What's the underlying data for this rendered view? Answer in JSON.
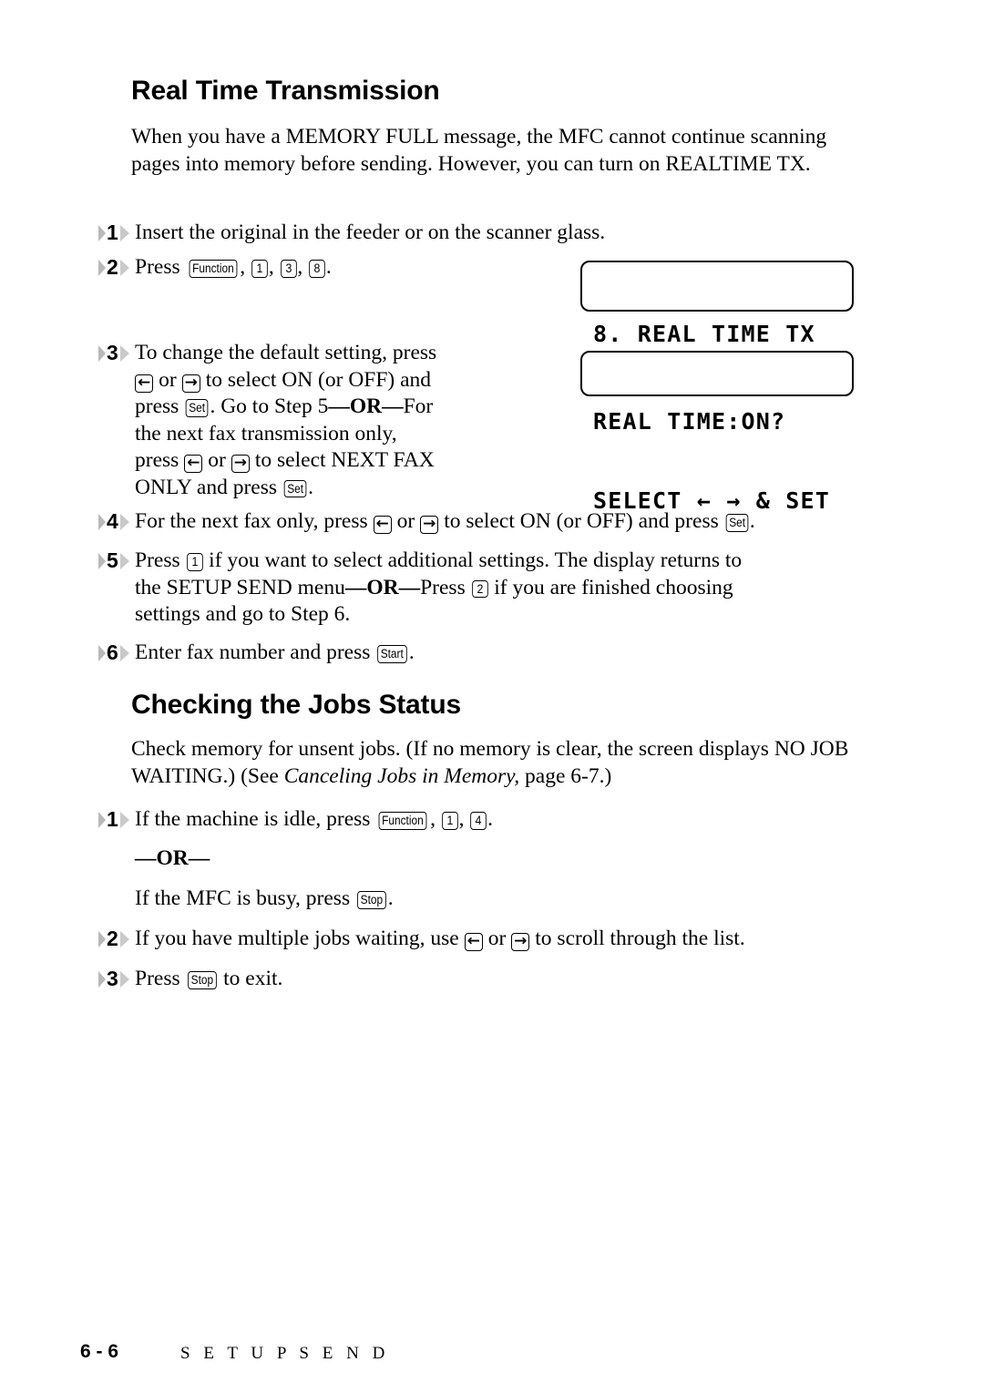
{
  "document": {
    "page_number": "6 - 6",
    "footer_title": "S E T U P   S E N D"
  },
  "sections": [
    {
      "id": "real-time-transmission",
      "heading": "Real Time Transmission",
      "intro": "When you have a MEMORY FULL message, the MFC cannot continue scanning pages into memory before sending. However, you can turn on REALTIME TX."
    },
    {
      "id": "checking-the-jobs-status",
      "heading": "Checking the Jobs Status",
      "intro_part1": "Check memory for unsent jobs. (If no memory is clear, the screen displays NO JOB WAITING.) (See ",
      "intro_italic": "Canceling Jobs in Memory,",
      "intro_part2": " page 6-7.)"
    }
  ],
  "steps_rtt": {
    "s1": {
      "num": "1",
      "text": "Insert the original in the feeder or on the scanner glass."
    },
    "s2": {
      "num": "2",
      "press_label": "Press",
      "keys": [
        "Function",
        "1",
        "3",
        "8"
      ],
      "trailing": "."
    },
    "s3": {
      "num": "3",
      "l1": "To change the default setting, press",
      "arrow_left": "←",
      "arrow_right": "→",
      "l2_mid": "or",
      "l2_tail": "to select ON (or OFF) and",
      "l3_pre": "press",
      "key_set": "Set",
      "l3_mid": ".  Go to Step 5",
      "or_text": "—OR—",
      "l3_tail": "For",
      "l4": "the next fax transmission only,",
      "l5_pre": "press",
      "l5_mid": "or",
      "l5_tail": "to select NEXT FAX",
      "l6_pre": "ONLY and press",
      "l6_tail": "."
    },
    "s4": {
      "num": "4",
      "t1": "For the next fax only, press",
      "t2": "or",
      "t3": "to select ON (or OFF) and press",
      "key_set": "Set",
      "t4": "."
    },
    "s5": {
      "num": "5",
      "t1": "Press",
      "key_1": "1",
      "t2": "if you want to select additional settings. The display returns to",
      "t3": "the SETUP SEND menu",
      "or_text": "—OR—",
      "t4": "Press",
      "key_2": "2",
      "t5": "if you are finished choosing",
      "t6": "settings and go to Step 6."
    },
    "s6": {
      "num": "6",
      "t1": "Enter fax number and press",
      "key_start": "Start",
      "t2": "."
    }
  },
  "steps_jobs": {
    "s1": {
      "num": "1",
      "t1": "If the machine is idle, press",
      "keys": [
        "Function",
        "1",
        "4"
      ],
      "t2": "."
    },
    "or_divider": "—OR—",
    "busy_line": {
      "t1": "If the MFC is busy, press",
      "key_stop": "Stop",
      "t2": "."
    },
    "s2": {
      "num": "2",
      "t1": "If you have multiple jobs waiting, use",
      "t2": "or",
      "t3": "to scroll through the list."
    },
    "s3": {
      "num": "3",
      "t1": "Press",
      "key_stop": "Stop",
      "t2": "to exit."
    }
  },
  "lcd_displays": [
    {
      "id": "lcd-real-time-tx",
      "line1": "8. REAL TIME TX",
      "line2": ""
    },
    {
      "id": "lcd-real-time-on",
      "line1": "REAL TIME:ON?",
      "line2": "SELECT ← → & SET"
    }
  ],
  "icons": {
    "arrow_left": "←",
    "arrow_right": "→"
  }
}
